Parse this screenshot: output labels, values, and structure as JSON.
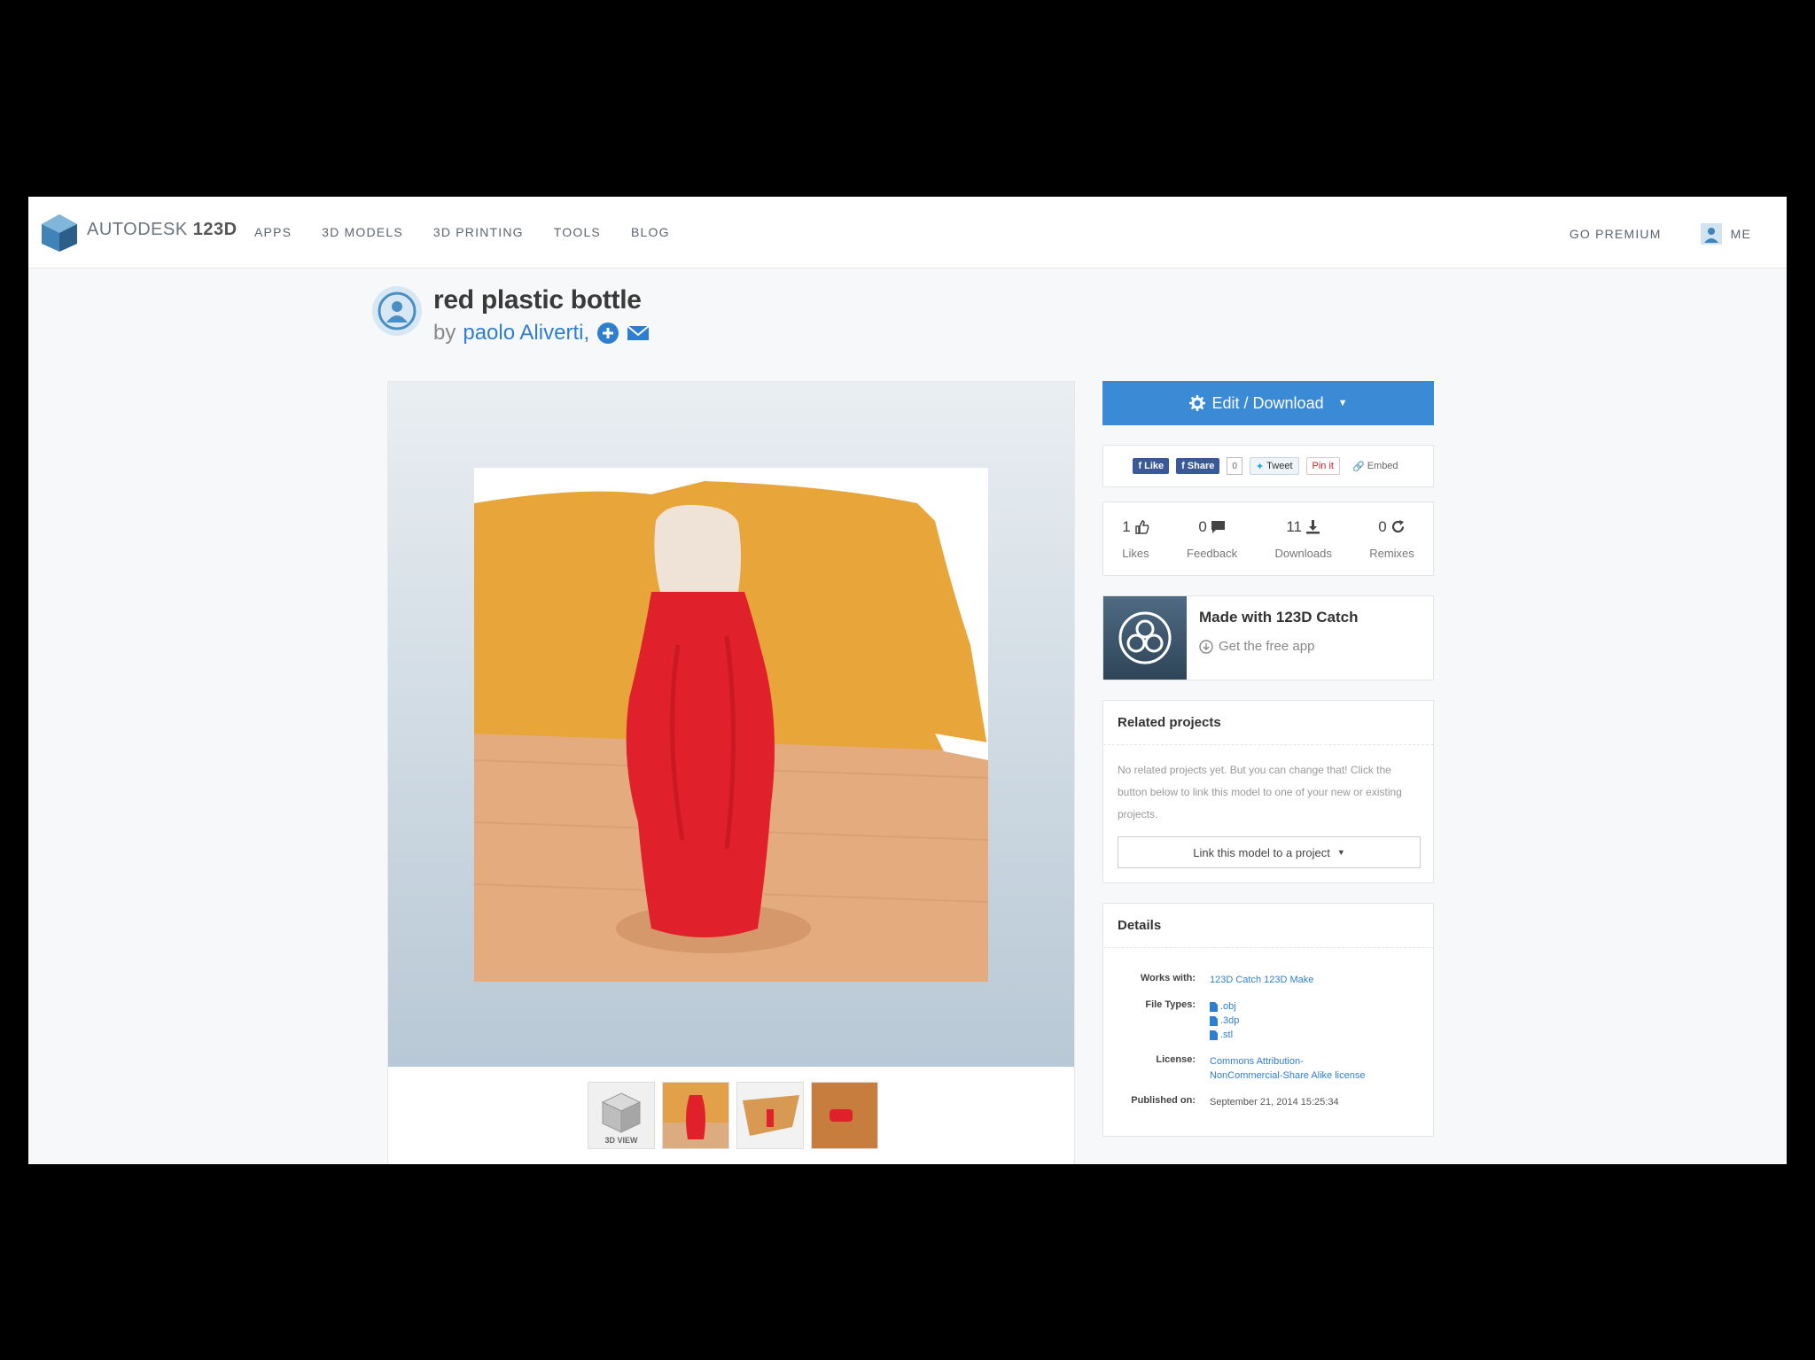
{
  "nav": {
    "brand": "AUTODESK",
    "brand_num": "123D",
    "items": [
      "APPS",
      "3D MODELS",
      "3D PRINTING",
      "TOOLS",
      "BLOG"
    ],
    "go_premium": "GO PREMIUM",
    "me": "ME"
  },
  "model": {
    "title": "red plastic bottle",
    "by": "by",
    "author": "paolo Aliverti,"
  },
  "viewer": {
    "thumb_3d_label": "3D VIEW"
  },
  "actions": {
    "edit_download": "Edit / Download"
  },
  "share": {
    "like": "Like",
    "share": "Share",
    "share_count": "0",
    "tweet": "Tweet",
    "pin": "Pin it",
    "embed": "Embed"
  },
  "stats": [
    {
      "value": "1",
      "label": "Likes"
    },
    {
      "value": "0",
      "label": "Feedback"
    },
    {
      "value": "11",
      "label": "Downloads"
    },
    {
      "value": "0",
      "label": "Remixes"
    }
  ],
  "catch": {
    "title": "Made with 123D Catch",
    "link": "Get the free app"
  },
  "related": {
    "heading": "Related projects",
    "text": "No related projects yet. But you can change that! Click the button below to link this model to one of your new or existing projects.",
    "button": "Link this model to a project"
  },
  "details": {
    "heading": "Details",
    "works_with_key": "Works with:",
    "works_with": "123D Catch 123D Make",
    "file_types_key": "File Types:",
    "file_types": [
      ".obj",
      ".3dp",
      ".stl"
    ],
    "license_key": "License:",
    "license_line1": "Commons Attribution-",
    "license_line2": "NonCommercial-Share Alike license",
    "published_key": "Published on:",
    "published": "September 21, 2014 15:25:34"
  },
  "colors": {
    "accent": "#3b8ad6",
    "link": "#2f7fd0",
    "facebook": "#3b5998"
  }
}
